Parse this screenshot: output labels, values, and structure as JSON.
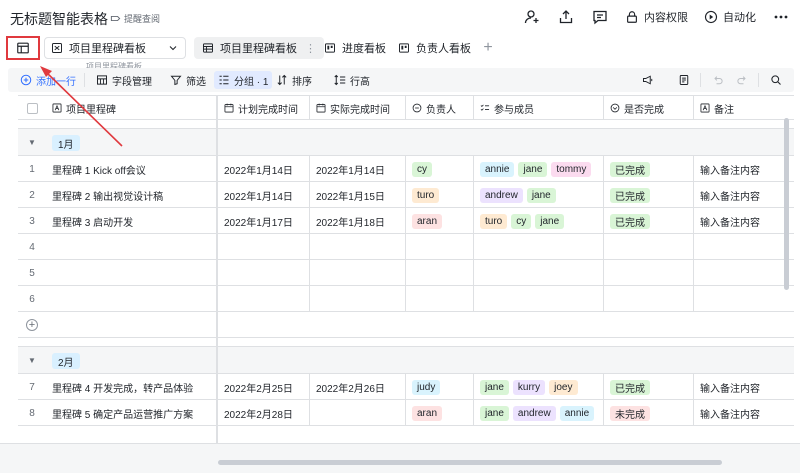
{
  "title": "无标题智能表格",
  "remind_label": "提醒查阅",
  "header_actions": {
    "share_user_icon": "add-user-icon",
    "export_icon": "upload-icon",
    "comment_icon": "comment-icon",
    "permission_label": "内容权限",
    "automation_label": "自动化",
    "more_icon": "more-icon"
  },
  "view_selector": {
    "label": "项目里程碑看板",
    "ghost": "项目里程碑看板"
  },
  "tabs": [
    {
      "label": "项目里程碑看板",
      "active": true
    },
    {
      "label": "进度看板",
      "active": false
    },
    {
      "label": "负责人看板",
      "active": false
    }
  ],
  "toolbar": {
    "add_row": "添加一行",
    "fields": "字段管理",
    "filter": "筛选",
    "group": "分组 · 1",
    "sort": "排序",
    "row_height": "行高"
  },
  "columns": [
    {
      "label": "项目里程碑",
      "icon": "text"
    },
    {
      "label": "计划完成时间",
      "icon": "date"
    },
    {
      "label": "实际完成时间",
      "icon": "date"
    },
    {
      "label": "负责人",
      "icon": "person"
    },
    {
      "label": "参与成员",
      "icon": "multi"
    },
    {
      "label": "是否完成",
      "icon": "single"
    },
    {
      "label": "备注",
      "icon": "text"
    }
  ],
  "groups": [
    {
      "label": "1月",
      "rows": [
        {
          "num": "1",
          "name": "里程碑 1 Kick off会议",
          "plan": "2022年1月14日",
          "actual": "2022年1月14日",
          "owner": "cy",
          "members": [
            "annie",
            "jane",
            "tommy"
          ],
          "done": "已完成",
          "note": "输入备注内容"
        },
        {
          "num": "2",
          "name": "里程碑 2 输出视觉设计稿",
          "plan": "2022年1月14日",
          "actual": "2022年1月15日",
          "owner": "turo",
          "members": [
            "andrew",
            "jane"
          ],
          "done": "已完成",
          "note": "输入备注内容"
        },
        {
          "num": "3",
          "name": "里程碑 3 启动开发",
          "plan": "2022年1月17日",
          "actual": "2022年1月18日",
          "owner": "aran",
          "members": [
            "turo",
            "cy",
            "jane"
          ],
          "done": "已完成",
          "note": "输入备注内容"
        },
        {
          "num": "4",
          "name": "",
          "plan": "",
          "actual": "",
          "owner": "",
          "members": [],
          "done": "",
          "note": ""
        },
        {
          "num": "5",
          "name": "",
          "plan": "",
          "actual": "",
          "owner": "",
          "members": [],
          "done": "",
          "note": ""
        },
        {
          "num": "6",
          "name": "",
          "plan": "",
          "actual": "",
          "owner": "",
          "members": [],
          "done": "",
          "note": ""
        }
      ]
    },
    {
      "label": "2月",
      "rows": [
        {
          "num": "7",
          "name": "里程碑 4 开发完成，转产品体验",
          "plan": "2022年2月25日",
          "actual": "2022年2月26日",
          "owner": "judy",
          "members": [
            "jane",
            "kurry",
            "joey"
          ],
          "done": "已完成",
          "note": "输入备注内容"
        },
        {
          "num": "8",
          "name": "里程碑 5 确定产品运营推广方案",
          "plan": "2022年2月28日",
          "actual": "",
          "owner": "aran",
          "members": [
            "jane",
            "andrew",
            "annie"
          ],
          "done": "未完成",
          "note": "输入备注内容"
        }
      ]
    }
  ],
  "person_colors": {
    "cy": "#d9f5d6",
    "turo": "#feead2",
    "aran": "#fde2e2",
    "judy": "#d9f3fd",
    "annie": "#d9f3fd",
    "jane": "#d9f5d6",
    "tommy": "#fbdbef",
    "andrew": "#ece2fe",
    "kurry": "#ece2fe",
    "joey": "#feead2"
  },
  "status_colors": {
    "已完成": "#d9f5d6",
    "未完成": "#fde2e2"
  },
  "highlight_color": "#e0393e"
}
